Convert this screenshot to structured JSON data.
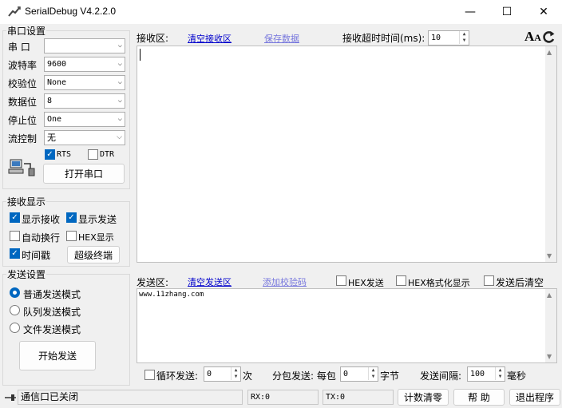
{
  "window": {
    "title": "SerialDebug V4.2.2.0",
    "min": "—",
    "max": "☐",
    "close": "✕"
  },
  "serial": {
    "group_title": "串口设置",
    "port_label": "串  口",
    "port_value": "",
    "baud_label": "波特率",
    "baud_value": "9600",
    "parity_label": "校验位",
    "parity_value": "None",
    "databits_label": "数据位",
    "databits_value": "8",
    "stopbits_label": "停止位",
    "stopbits_value": "One",
    "flow_label": "流控制",
    "flow_value": "无",
    "rts_label": "RTS",
    "dtr_label": "DTR",
    "open_button": "打开串口"
  },
  "receive_display": {
    "group_title": "接收显示",
    "show_receive": "显示接收",
    "show_send": "显示发送",
    "auto_wrap": "自动换行",
    "hex_display": "HEX显示",
    "timestamp": "时间戳",
    "terminal_button": "超级终端"
  },
  "send_settings": {
    "group_title": "发送设置",
    "mode_normal": "普通发送模式",
    "mode_queue": "队列发送模式",
    "mode_file": "文件发送模式",
    "start_button": "开始发送"
  },
  "receive_area": {
    "label": "接收区:",
    "clear_link": "清空接收区",
    "save_link": "保存数据",
    "timeout_label": "接收超时时间(ms):",
    "timeout_value": "10",
    "font_icon_label": "A"
  },
  "send_area": {
    "label": "发送区:",
    "clear_link": "清空发送区",
    "checksum_link": "添加校验码",
    "hex_send": "HEX发送",
    "hex_format": "HEX格式化显示",
    "clear_after": "发送后清空",
    "content": "www.11zhang.com"
  },
  "send_options": {
    "loop_label": "循环发送:",
    "loop_value": "0",
    "loop_unit": "次",
    "packet_label": "分包发送: 每包",
    "packet_value": "0",
    "packet_unit": "字节",
    "interval_label": "发送间隔:",
    "interval_value": "100",
    "interval_unit": "毫秒"
  },
  "status": {
    "message": "通信口已关闭",
    "rx": "RX:0",
    "tx": "TX:0",
    "reset_button": "计数清零",
    "help_button": "帮  助",
    "exit_button": "退出程序"
  }
}
